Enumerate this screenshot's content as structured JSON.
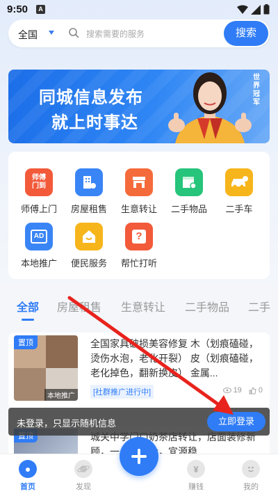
{
  "status_bar": {
    "time": "9:50",
    "notification_letter": "A"
  },
  "search": {
    "region": "全国",
    "placeholder": "搜索需要的服务",
    "button_label": "搜索"
  },
  "banner": {
    "title": "同城信息发布",
    "subtitle": "就上时事达",
    "seal_text": "世界冠军"
  },
  "services": [
    {
      "label": "师傅上门",
      "icon_text": "师傅门到",
      "icon": "worker-icon",
      "color": "#f25a3a"
    },
    {
      "label": "房屋租售",
      "icon_text": "",
      "icon": "building-icon",
      "color": "#3a85f5"
    },
    {
      "label": "生意转让",
      "icon_text": "",
      "icon": "shop-icon",
      "color": "#f56a3a"
    },
    {
      "label": "二手物品",
      "icon_text": "",
      "icon": "box-icon",
      "color": "#27c47b"
    },
    {
      "label": "二手车",
      "icon_text": "",
      "icon": "car-icon",
      "color": "#f7b51c"
    },
    {
      "label": "本地推广",
      "icon_text": "AD",
      "icon": "ad-icon",
      "color": "#3a85f5"
    },
    {
      "label": "便民服务",
      "icon_text": "",
      "icon": "smile-house-icon",
      "color": "#f7b51c"
    },
    {
      "label": "帮忙打听",
      "icon_text": "?",
      "icon": "question-icon",
      "color": "#f25a3a"
    }
  ],
  "tabs": [
    "全部",
    "房屋租售",
    "生意转让",
    "二手物品",
    "二手"
  ],
  "listing": {
    "badge": "置顶",
    "tag": "本地推广",
    "description": "全国家具破损美容修复 木（划痕磕碰，烫伤水泡，老化开裂） 皮（划痕磕碰，老化掉色，翻新换皮） 金属...",
    "promo": "[社群推广进行中]",
    "views": "19",
    "likes": "0"
  },
  "listing2": {
    "badge": "置顶",
    "description": "城关中学门口奶茶店转让，店面装修新顾，一上流量大，宜源稳"
  },
  "login_toast": {
    "text": "未登录，只显示随机信息",
    "button_label": "立即登录"
  },
  "bottom_nav": [
    {
      "label": "首页",
      "icon": "home-icon",
      "active": true
    },
    {
      "label": "发现",
      "icon": "planet-icon",
      "active": false
    },
    {
      "label": "",
      "icon": "plus-icon",
      "active": false
    },
    {
      "label": "赚钱",
      "icon": "yuan-icon",
      "active": false
    },
    {
      "label": "我的",
      "icon": "smile-icon",
      "active": false
    }
  ],
  "colors": {
    "accent": "#2f7cf6",
    "annotation": "#e8231d"
  }
}
